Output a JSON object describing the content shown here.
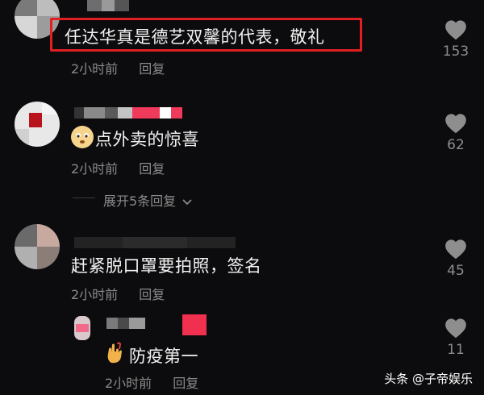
{
  "comments": [
    {
      "text": "任达华真是德艺双馨的代表，敬礼",
      "time": "2小时前",
      "reply": "回复",
      "likes": "153"
    },
    {
      "text": "点外卖的惊喜",
      "time": "2小时前",
      "reply": "回复",
      "likes": "62",
      "expand": "展开5条回复"
    },
    {
      "text": "赶紧脱口罩要拍照，签名",
      "time": "2小时前",
      "reply": "回复",
      "likes": "45"
    },
    {
      "text": "防疫第一",
      "time": "2小时前",
      "reply": "回复",
      "likes": "11"
    }
  ],
  "watermark": "头条 @子帝娱乐",
  "icons": {
    "like": "heart-icon",
    "expand": "chevron-down-icon",
    "emoji2": "worried-face-emoji",
    "emoji4": "love-you-hand-emoji"
  },
  "colors": {
    "background": "#0c0c0e",
    "highlight": "#e02020",
    "muted": "#8a8a8a"
  }
}
